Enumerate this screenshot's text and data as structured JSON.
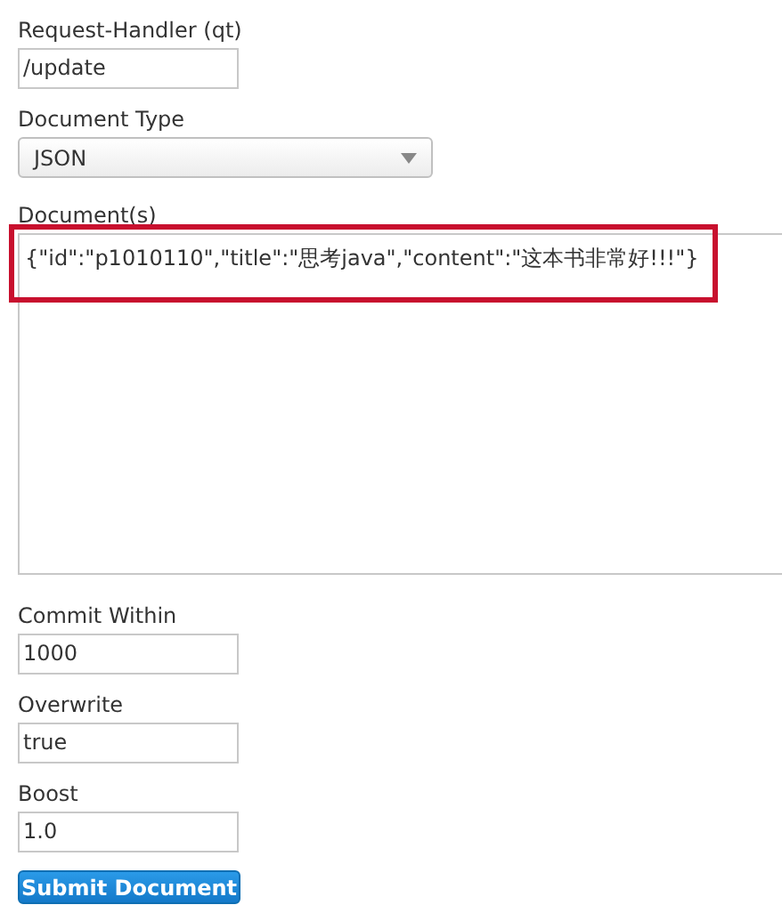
{
  "fields": [
    {
      "kind": "text",
      "label": "Request-Handler (qt)",
      "value": "/update"
    },
    {
      "kind": "select",
      "label": "Document Type",
      "value": "JSON"
    },
    {
      "kind": "textarea",
      "label": "Document(s)",
      "value": "{\"id\":\"p1010110\",\"title\":\"思考java\",\"content\":\"这本书非常好!!!\"}",
      "highlighted": true
    },
    {
      "kind": "text",
      "label": "Commit Within",
      "value": "1000"
    },
    {
      "kind": "text",
      "label": "Overwrite",
      "value": "true"
    },
    {
      "kind": "text",
      "label": "Boost",
      "value": "1.0"
    }
  ],
  "submit_button": "Submit Document"
}
